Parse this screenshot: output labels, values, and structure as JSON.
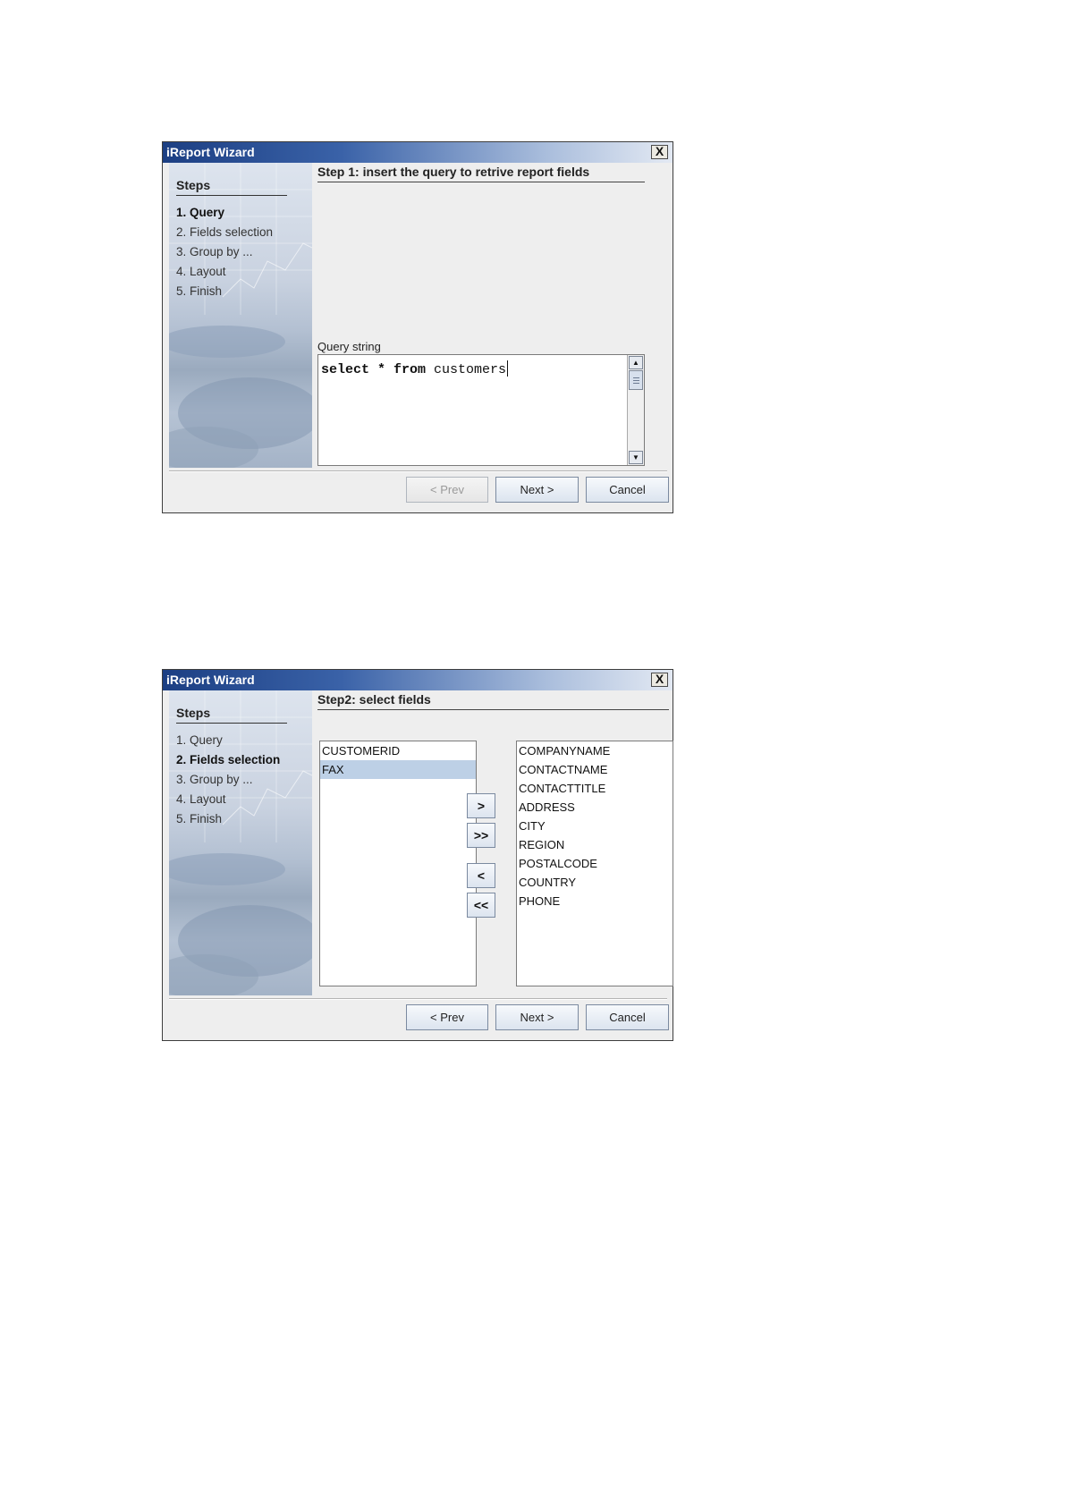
{
  "wizard1": {
    "title": "iReport Wizard",
    "close_label": "X",
    "steps_header": "Steps",
    "steps": [
      "1. Query",
      "2. Fields selection",
      "3. Group by ...",
      "4. Layout",
      "5. Finish"
    ],
    "active_step_index": 0,
    "step_title": "Step 1: insert the query to retrive report fields",
    "query_label": "Query string",
    "query_keywords_1": "select * from",
    "query_table": " customers",
    "buttons": {
      "prev": "< Prev",
      "next": "Next >",
      "cancel": "Cancel"
    },
    "prev_enabled": false
  },
  "wizard2": {
    "title": "iReport Wizard",
    "close_label": "X",
    "steps_header": "Steps",
    "steps": [
      "1. Query",
      "2. Fields selection",
      "3. Group by ...",
      "4. Layout",
      "5. Finish"
    ],
    "active_step_index": 1,
    "step_title": "Step2: select fields",
    "available_fields": [
      "CUSTOMERID",
      "FAX"
    ],
    "selected_available_index": 1,
    "selected_fields": [
      "COMPANYNAME",
      "CONTACTNAME",
      "CONTACTTITLE",
      "ADDRESS",
      "CITY",
      "REGION",
      "POSTALCODE",
      "COUNTRY",
      "PHONE"
    ],
    "move_buttons": {
      "add_one": ">",
      "add_all": ">>",
      "remove_one": "<",
      "remove_all": "<<"
    },
    "buttons": {
      "prev": "< Prev",
      "next": "Next >",
      "cancel": "Cancel"
    },
    "prev_enabled": true
  }
}
